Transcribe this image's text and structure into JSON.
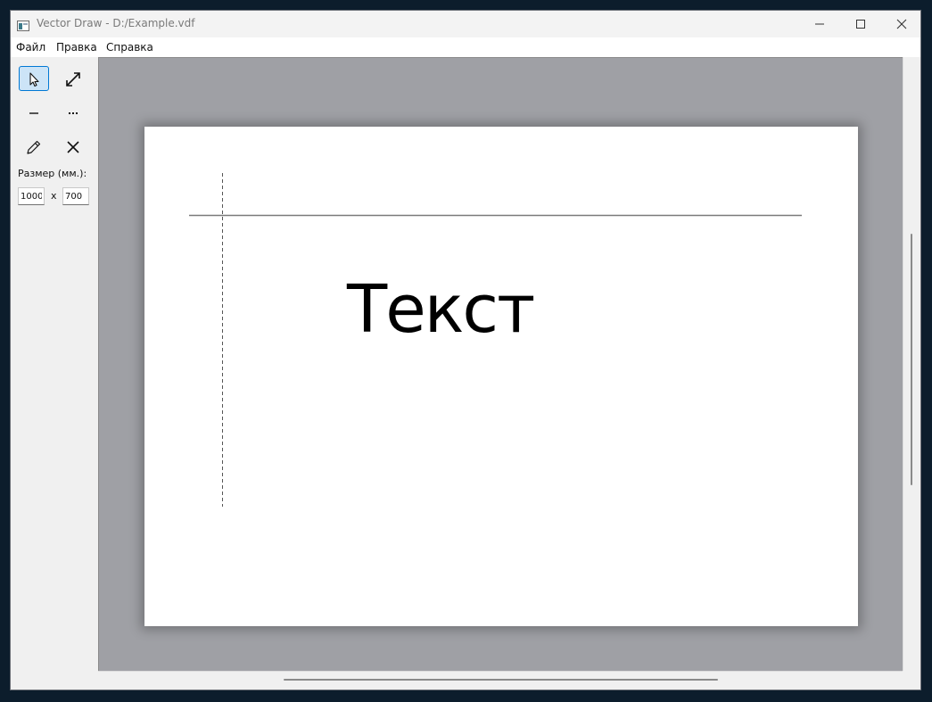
{
  "window": {
    "title": "Vector Draw - D:/Example.vdf",
    "icons": {
      "app": "app-icon",
      "minimize": "minimize-icon",
      "maximize": "maximize-icon",
      "close": "close-icon"
    }
  },
  "menu": {
    "items": [
      {
        "label": "Файл"
      },
      {
        "label": "Правка"
      },
      {
        "label": "Справка"
      }
    ]
  },
  "tools": {
    "items": [
      {
        "icon": "cursor-select-icon",
        "active": true
      },
      {
        "icon": "resize-arrow-icon",
        "active": false
      },
      {
        "icon": "solid-line-icon",
        "active": false
      },
      {
        "icon": "dotted-line-icon",
        "active": false
      },
      {
        "icon": "pencil-icon",
        "active": false
      },
      {
        "icon": "delete-x-icon",
        "active": false
      }
    ],
    "accent_color": "#0078d4"
  },
  "size": {
    "label": "Размер (мм.):",
    "width": "1000",
    "separator": "x",
    "height": "700"
  },
  "canvas": {
    "background_color": "#9fa0a5",
    "page_color": "#ffffff",
    "text": "Текст"
  }
}
